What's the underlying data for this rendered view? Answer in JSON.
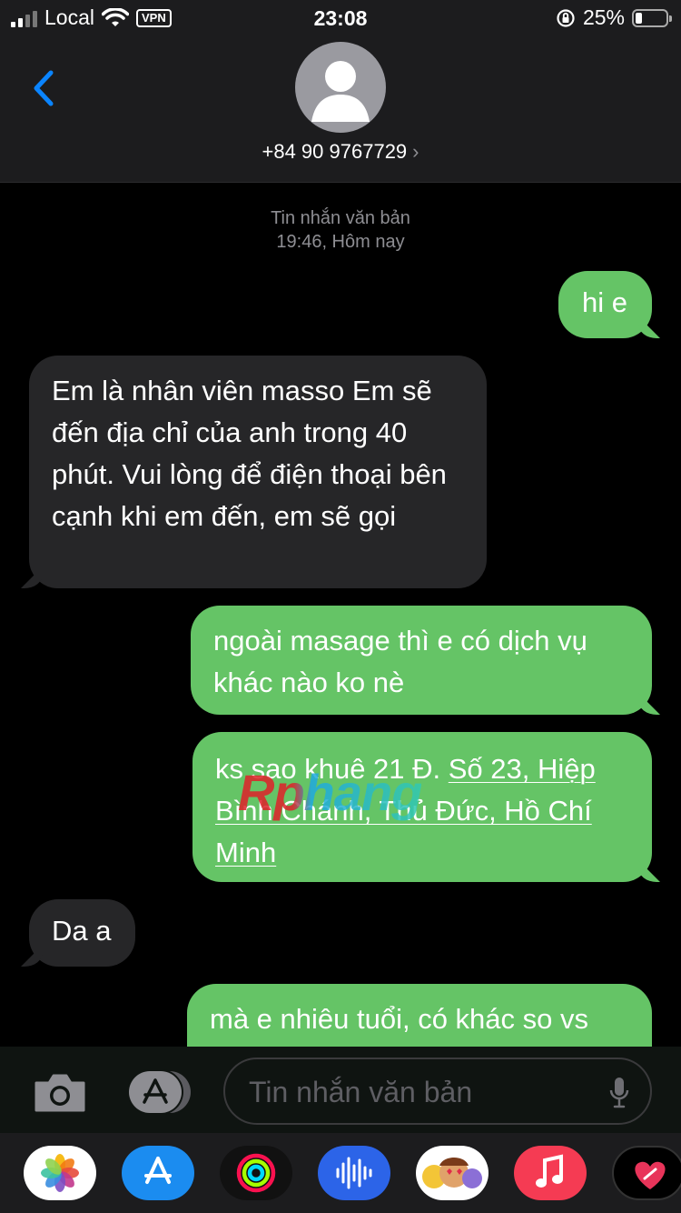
{
  "status_bar": {
    "carrier": "Local",
    "vpn": "VPN",
    "time": "23:08",
    "battery": "25%"
  },
  "header": {
    "contact": "+84 90 9767729",
    "chevron": "›"
  },
  "conversation": {
    "timestamp_line1": "Tin nhắn văn bản",
    "timestamp_line2": "19:46, Hôm nay",
    "messages": [
      {
        "direction": "outgoing",
        "text": "hi e"
      },
      {
        "direction": "incoming",
        "text": "Em là nhân viên masso Em sẽ đến địa chỉ của anh  trong 40 phút. Vui lòng để điện thoại bên cạnh  khi em đến, em sẽ gọi"
      },
      {
        "direction": "outgoing",
        "text": "ngoài masage thì e có dịch vụ khác nào ko nè"
      },
      {
        "direction": "outgoing",
        "text_prefix": "ks sao khuê 21 Đ. ",
        "text_link": "Số 23, Hiệp Bình Chánh, Thủ Đức, Hồ Chí Minh"
      },
      {
        "direction": "incoming",
        "text": "Da a"
      },
      {
        "direction": "outgoing",
        "text": "mà e nhiêu tuổi, có khác so vs"
      }
    ],
    "watermark": "Rphang"
  },
  "input_bar": {
    "placeholder": "Tin nhắn văn bản"
  },
  "app_drawer": {
    "apps": [
      "photos-icon",
      "app-store-icon",
      "activity-icon",
      "audio-message-icon",
      "memoji-icon",
      "music-icon",
      "digital-touch-icon"
    ]
  },
  "colors": {
    "outgoing_bubble": "#65c466",
    "incoming_bubble": "#262628",
    "accent": "#0a84ff"
  }
}
